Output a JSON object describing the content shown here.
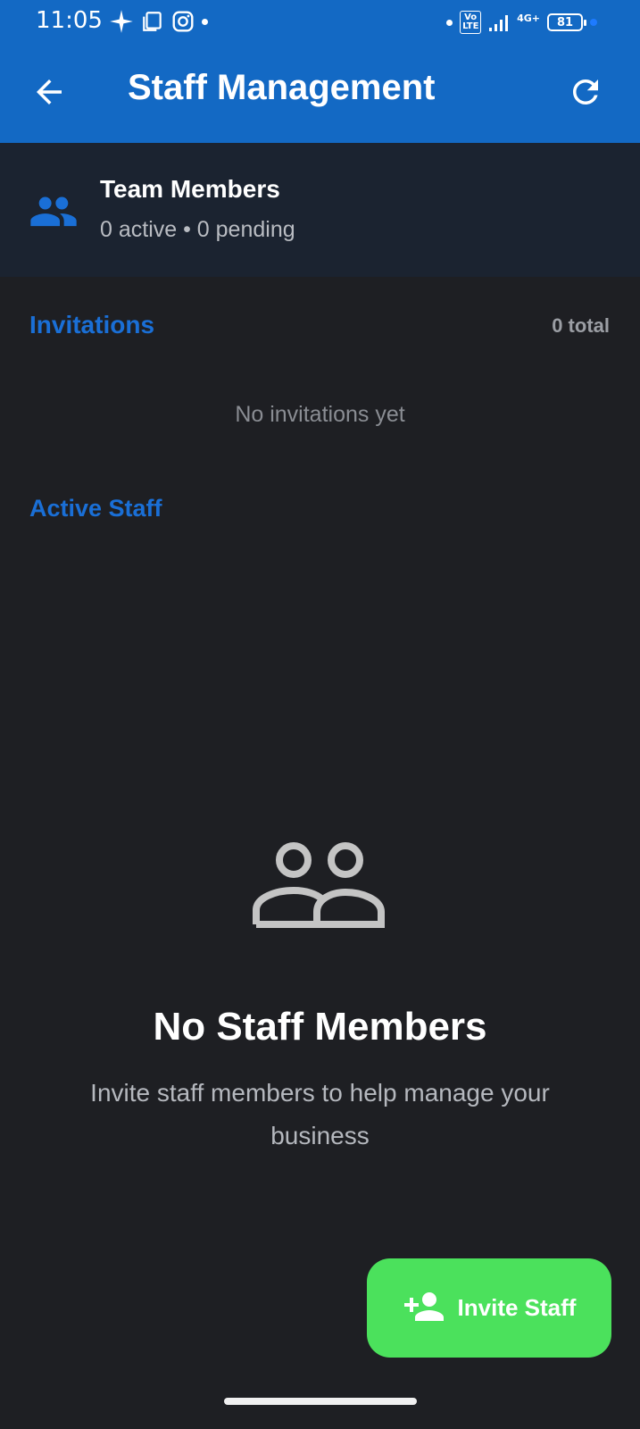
{
  "status_bar": {
    "time": "11:05",
    "network_badge": "Vo LTE",
    "network_type": "4G+",
    "battery": "81"
  },
  "app_bar": {
    "title": "Staff Management"
  },
  "team_card": {
    "title": "Team Members",
    "subtitle": "0 active • 0 pending"
  },
  "invitations": {
    "title": "Invitations",
    "count": "0 total",
    "empty_text": "No invitations yet"
  },
  "active_staff": {
    "title": "Active Staff",
    "empty_title": "No Staff Members",
    "empty_desc": "Invite staff members to help manage your business"
  },
  "fab": {
    "label": "Invite Staff"
  },
  "colors": {
    "app_bar": "#1369c4",
    "background": "#1e1f23",
    "header_card": "#1b2330",
    "accent": "#1a6fd6",
    "fab": "#4be15c"
  },
  "icons": {
    "back": "arrow-left-icon",
    "refresh": "refresh-icon",
    "team": "people-icon",
    "empty": "people-outline-icon",
    "fab": "person-add-icon"
  }
}
